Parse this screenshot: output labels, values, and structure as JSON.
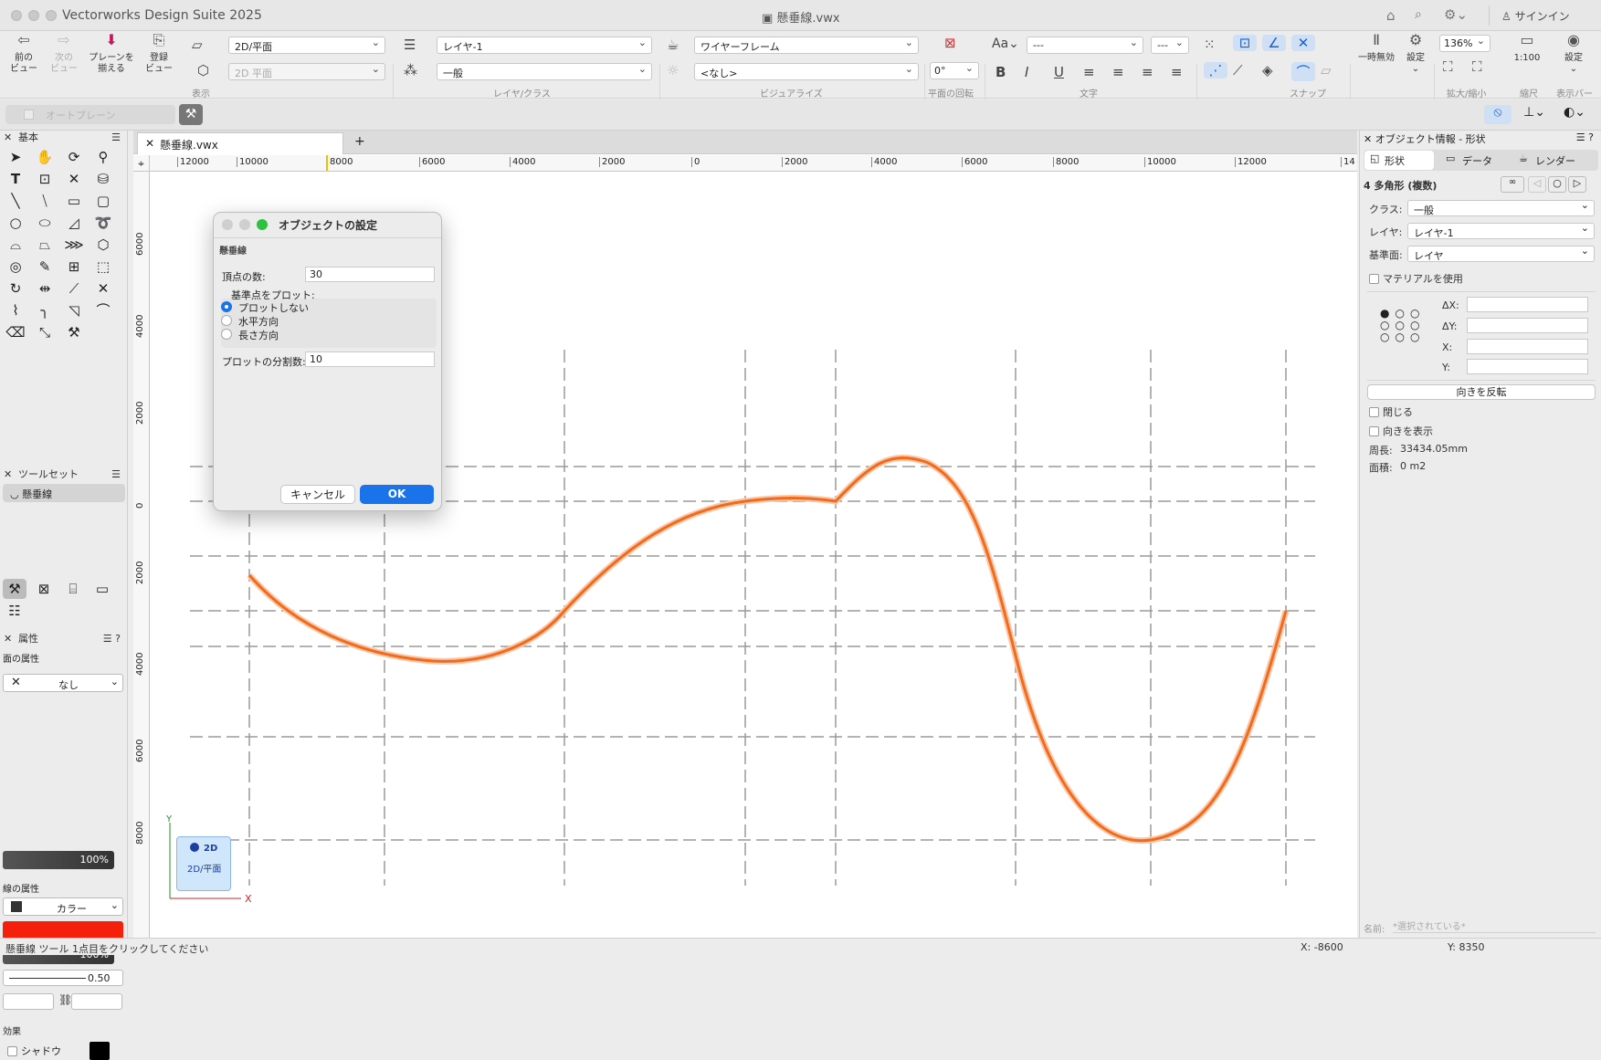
{
  "window": {
    "app_title": "Vectorworks Design Suite 2025",
    "doc_title": "懸垂線.vwx",
    "signin": "サインイン"
  },
  "toolbar": {
    "prev_view": "前の\nビュー",
    "next_view": "次の\nビュー",
    "align_plane": "プレーンを\n揃える",
    "reg_view": "登録\nビュー",
    "view_select": "2D/平面",
    "plane_select": "2D 平面",
    "layer_select": "レイヤ-1",
    "class_select": "一般",
    "render_select": "ワイヤーフレーム",
    "visualize_select": "<なし>",
    "rotation_value": "0°",
    "text_font": "---",
    "text_size": "---",
    "pause": "一時無効",
    "settings": "設定",
    "zoom": "136%",
    "scale": "1:100",
    "showbar": "設定",
    "groups": {
      "view": "表示",
      "layer_class": "レイヤ/クラス",
      "visualize": "ビジュアライズ",
      "plane_rotation": "平面の回転",
      "text": "文字",
      "snap": "スナップ",
      "zoom": "拡大/縮小",
      "scale": "縮尺",
      "showbar": "表示バー"
    },
    "autoplane": "オートプレーン"
  },
  "left": {
    "basic_title": "基本",
    "toolset_title": "ツールセット",
    "active_tool": "懸垂線",
    "attr_title": "属性",
    "fill_label": "面の属性",
    "fill_value": "なし",
    "fill_opacity": "100%",
    "line_label": "線の属性",
    "line_value": "カラー",
    "line_color": "#f5200b",
    "line_opacity": "100%",
    "line_weight": "0.50",
    "effects": "効果",
    "shadow": "シャドウ"
  },
  "canvas": {
    "tab": "懸垂線.vwx",
    "h_ruler": [
      "12000",
      "10000",
      "8000",
      "6000",
      "4000",
      "2000",
      "0",
      "2000",
      "4000",
      "6000",
      "8000",
      "10000",
      "12000",
      "14"
    ],
    "v_ruler": [
      "6000",
      "4000",
      "2000",
      "0",
      "2000",
      "4000",
      "6000",
      "8000"
    ],
    "plane_badge": "2D",
    "plane_sub": "2D/平面",
    "axis_x": "X",
    "axis_y": "Y",
    "curve_color": "#f26a1b"
  },
  "dialog": {
    "title": "オブジェクトの設定",
    "section": "懸垂線",
    "vertex_label": "頂点の数:",
    "vertex_value": "30",
    "plot_label": "基準点をプロット:",
    "options": [
      "プロットしない",
      "水平方向",
      "長さ方向"
    ],
    "selected": 0,
    "div_label": "プロットの分割数:",
    "div_value": "10",
    "cancel": "キャンセル",
    "ok": "OK"
  },
  "right": {
    "title": "オブジェクト情報 - 形状",
    "tabs": [
      "形状",
      "データ",
      "レンダー"
    ],
    "object_type": "4 多角形 (複数)",
    "class_label": "クラス:",
    "class_value": "一般",
    "layer_label": "レイヤ:",
    "layer_value": "レイヤ-1",
    "plane_label": "基準面:",
    "plane_value": "レイヤ",
    "material": "マテリアルを使用",
    "dx": "ΔX:",
    "dy": "ΔY:",
    "x": "X:",
    "y": "Y:",
    "reverse": "向きを反転",
    "close": "閉じる",
    "show_dir": "向きを表示",
    "perimeter_label": "周長:",
    "perimeter_value": "33434.05mm",
    "area_label": "面積:",
    "area_value": "0 m2",
    "name_label": "名前:",
    "name_placeholder": "*選択されている*"
  },
  "status": {
    "tool_msg": "懸垂線 ツール   1点目をクリックしてください",
    "x": "X: -8600",
    "y": "Y: 8350"
  }
}
